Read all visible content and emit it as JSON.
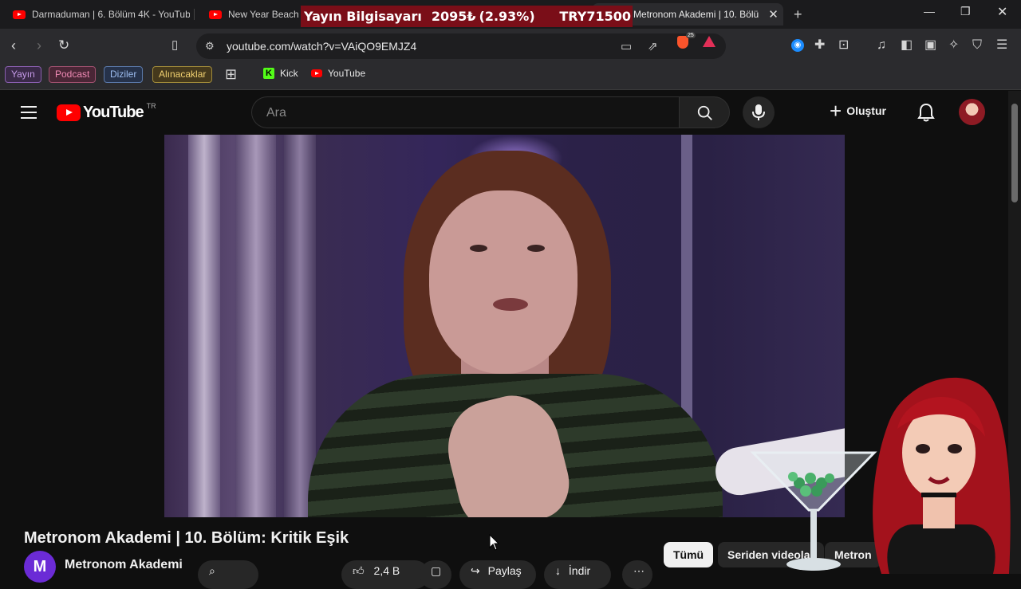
{
  "browser": {
    "tabs": [
      {
        "title": "Darmaduman | 6. Bölüm 4K - YouTub"
      },
      {
        "title": "New Year Beach V"
      },
      {
        "title": "Metronom Akademi | 10. Bölü",
        "active": true
      }
    ],
    "address": "youtube.com/watch?v=VAiQO9EMJZ4",
    "brave_badge": "25",
    "bookmarks": [
      {
        "label": "Yayın",
        "color": "#b58ad8"
      },
      {
        "label": "Podcast",
        "color": "#e07aa7"
      },
      {
        "label": "Diziler",
        "color": "#8fb0e8"
      },
      {
        "label": "Alınacaklar",
        "color": "#e0c060"
      },
      {
        "label": "Kick"
      },
      {
        "label": "YouTube"
      }
    ]
  },
  "ticker": {
    "label": "Yayın Bilgisayarı",
    "price": "2095₺",
    "change": "(2.93%)",
    "symbol": "TRY71500"
  },
  "youtube": {
    "country": "TR",
    "logo_text": "YouTube",
    "search_placeholder": "Ara",
    "create_label": "Oluştur",
    "video_title": "Metronom Akademi | 10. Bölüm: Kritik Eşik",
    "channel_name": "Metronom Akademi",
    "channel_initial": "M",
    "actions": {
      "likes": "2,4 B",
      "share": "Paylaş",
      "download": "İndir"
    },
    "chips": [
      "Tümü",
      "Seriden videolar",
      "Metron"
    ]
  },
  "colors": {
    "accent_red": "#ff0000",
    "ticker_bg": "#7a0e18",
    "page_bg": "#0f0f0f"
  }
}
